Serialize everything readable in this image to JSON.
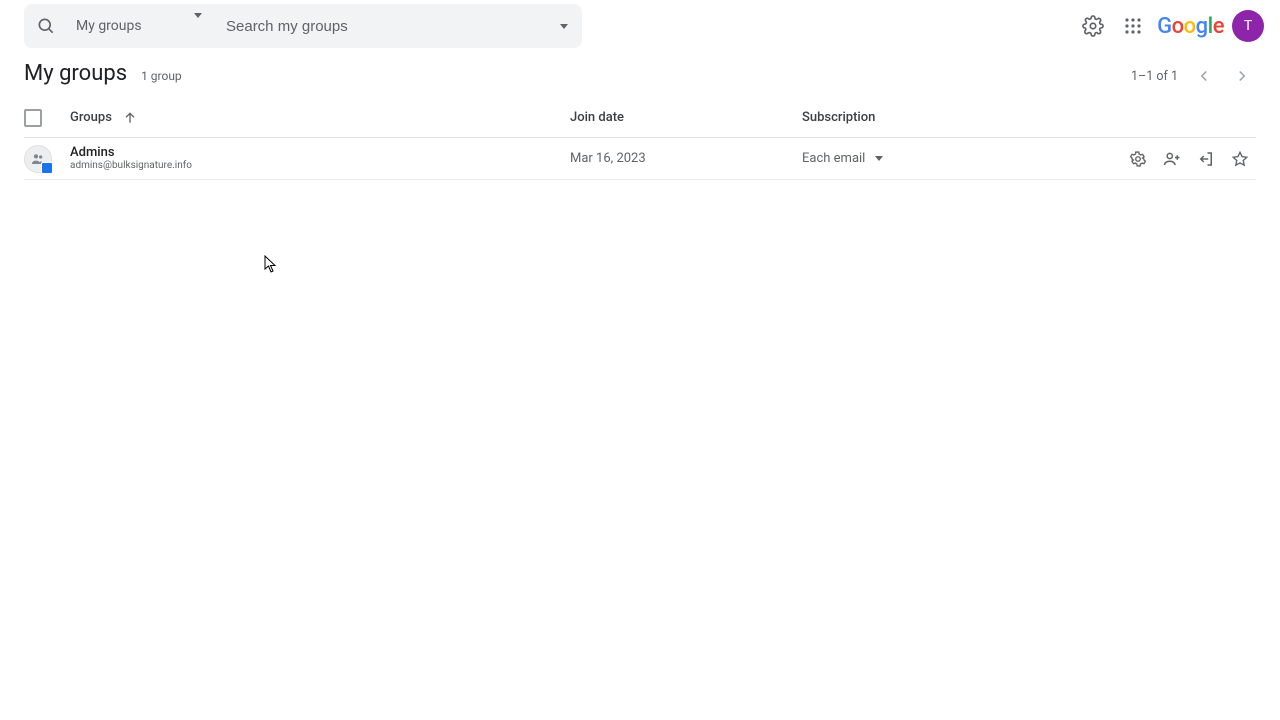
{
  "search": {
    "scope_label": "My groups",
    "placeholder": "Search my groups"
  },
  "avatar_initial": "T",
  "page": {
    "title": "My groups",
    "group_count": "1 group",
    "pager_text": "1–1 of 1"
  },
  "columns": {
    "groups": "Groups",
    "join_date": "Join date",
    "subscription": "Subscription"
  },
  "rows": [
    {
      "name": "Admins",
      "email": "admins@bulksignature.info",
      "join_date": "Mar 16, 2023",
      "subscription": "Each email"
    }
  ]
}
